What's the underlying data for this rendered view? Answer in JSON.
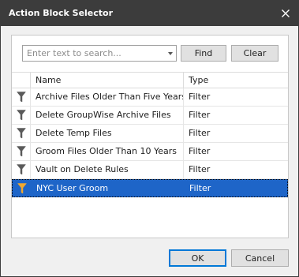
{
  "window": {
    "title": "Action Block Selector",
    "close_icon": "close-icon"
  },
  "search": {
    "placeholder": "Enter text to search...",
    "value": "",
    "find_label": "Find",
    "clear_label": "Clear"
  },
  "table": {
    "columns": {
      "icon": "",
      "name": "Name",
      "type": "Type"
    },
    "rows": [
      {
        "icon": "funnel-icon",
        "name": "Archive Files Older Than Five Years",
        "type": "Filter",
        "selected": false
      },
      {
        "icon": "funnel-icon",
        "name": "Delete GroupWise Archive Files",
        "type": "Filter",
        "selected": false
      },
      {
        "icon": "funnel-icon",
        "name": "Delete Temp Files",
        "type": "Filter",
        "selected": false
      },
      {
        "icon": "funnel-icon",
        "name": "Groom Files Older Than 10 Years",
        "type": "Filter",
        "selected": false
      },
      {
        "icon": "funnel-icon",
        "name": "Vault on Delete Rules",
        "type": "Filter",
        "selected": false
      },
      {
        "icon": "funnel-icon",
        "name": "NYC User Groom",
        "type": "Filter",
        "selected": true
      }
    ]
  },
  "footer": {
    "ok_label": "OK",
    "cancel_label": "Cancel"
  },
  "colors": {
    "titlebar": "#3c3c3c",
    "selection": "#1e65c8",
    "accent": "#0078d7",
    "funnel_selected": "#f0a830"
  }
}
